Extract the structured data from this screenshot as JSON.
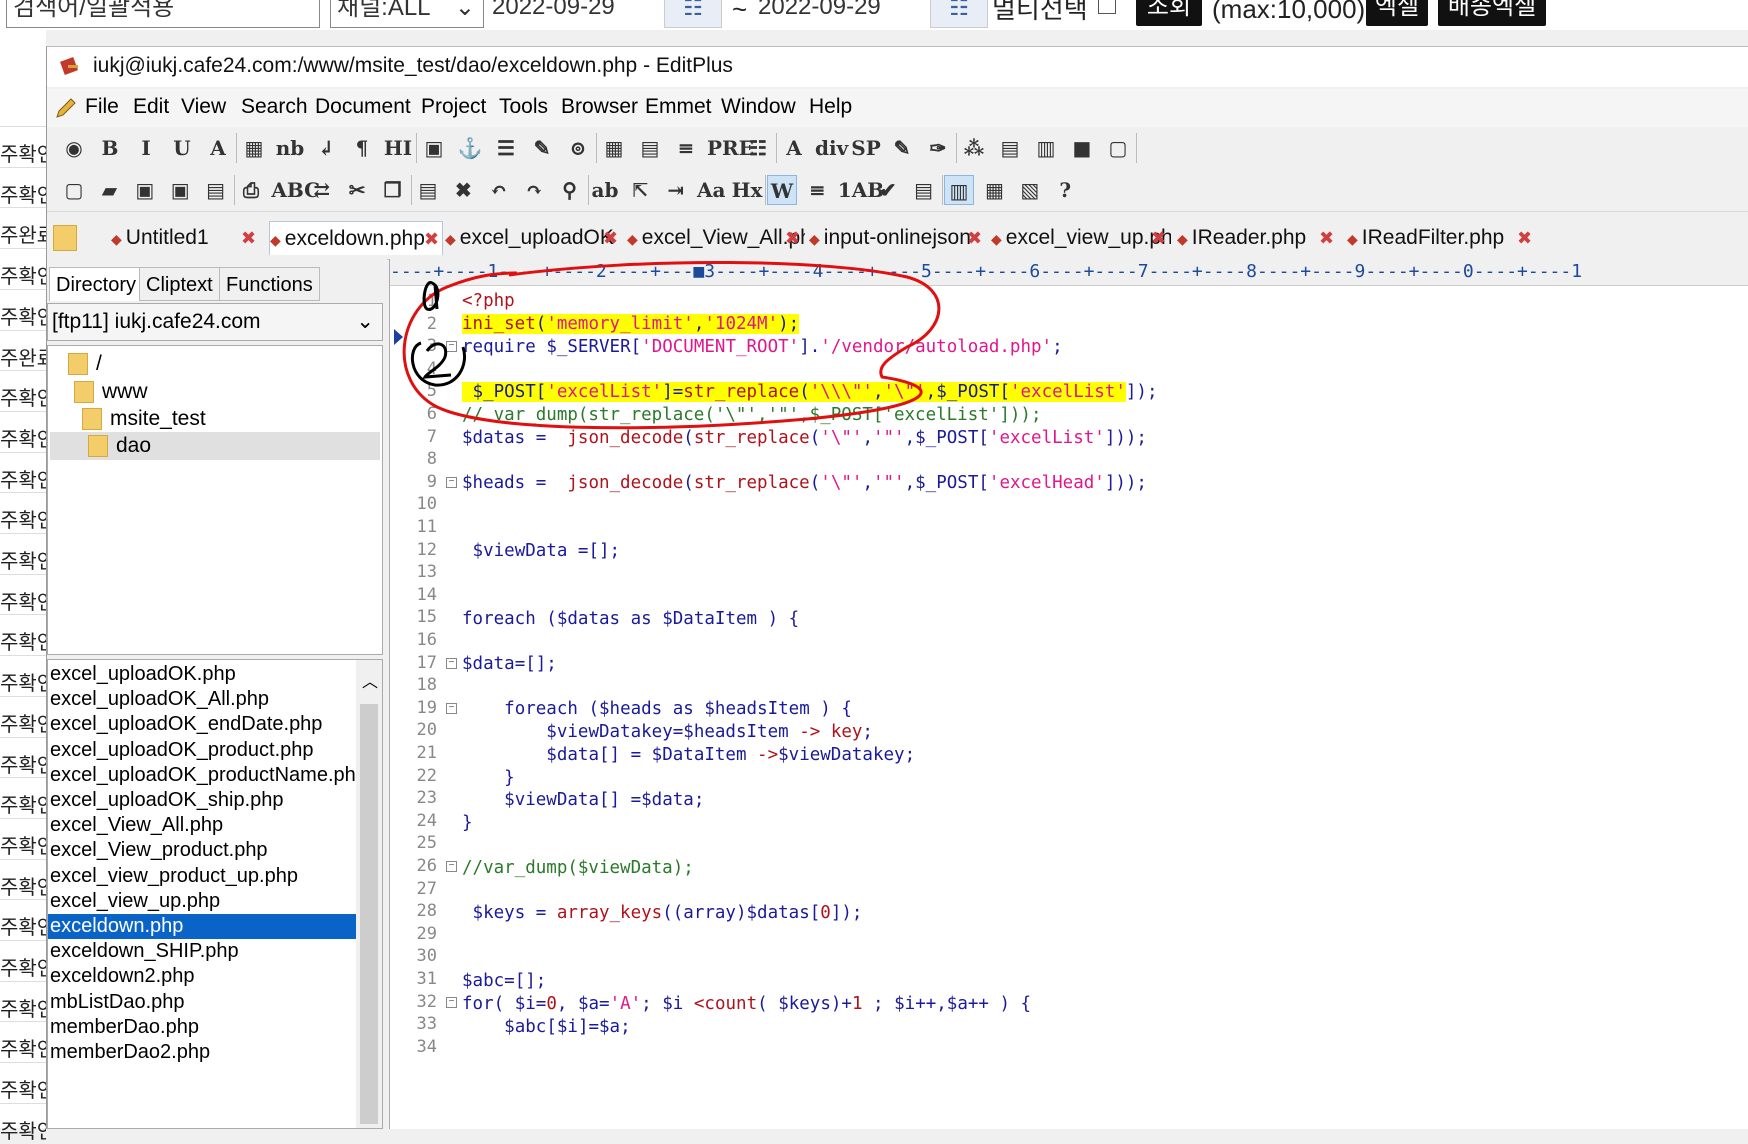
{
  "web": {
    "search_placeholder": "검색어/일괄적용",
    "channel": "채널:ALL",
    "date_from": "2022-09-29",
    "date_sep": "~",
    "date_to": "2022-09-29",
    "multi_select": "멀티선택",
    "search_btn": "조회",
    "max_text": "(max:10,000)",
    "excel_btn": "엑셀",
    "ship_excel_btn": "배송엑셀",
    "left_labels": [
      "주확인",
      "주확인",
      "주완료",
      "주확인",
      "주확인",
      "주완료",
      "주확인",
      "주확인",
      "주확인",
      "주확인",
      "주확인",
      "주확인",
      "주확인",
      "주확인",
      "주확인",
      "주확인",
      "주확인",
      "주확인",
      "주확인",
      "주확인",
      "주확인",
      "주확인",
      "주확인",
      "주확인",
      "주확인"
    ]
  },
  "window": {
    "title": "iukj@iukj.cafe24.com:/www/msite_test/dao/exceldown.php - EditPlus",
    "menu": [
      "File",
      "Edit",
      "View",
      "Search",
      "Document",
      "Project",
      "Tools",
      "Browser",
      "Emmet",
      "Window",
      "Help"
    ]
  },
  "toolbar1": {
    "icons": [
      "globe-icon",
      "bold-icon",
      "italic-icon",
      "underline-icon",
      "font-color-icon",
      "color-grid-icon",
      "nbsp-icon",
      "line-break-icon",
      "paragraph-icon",
      "horizontal-rule-icon",
      "image-icon",
      "anchor-icon",
      "hr-lines-icon",
      "edit-box-icon",
      "stamp-icon",
      "table-icon",
      "form-icon",
      "align-icon",
      "pre-icon",
      "list-icon",
      "font-a-icon",
      "div-icon",
      "span-icon",
      "pencil-icon",
      "brush-icon",
      "pills-icon",
      "frame-icon",
      "layout-icon",
      "palette-icon",
      "window-icon"
    ],
    "glyphs": [
      "◉",
      "B",
      "I",
      "U",
      "A",
      "▦",
      "nb",
      "↲",
      "¶",
      "HI",
      "▣",
      "⚓",
      "☰",
      "✎",
      "⊚",
      "▦",
      "▤",
      "≡",
      "PRE",
      "☷",
      "A",
      "div",
      "SP",
      "✎",
      "✑",
      "⁂",
      "▤",
      "▥",
      "■",
      "▢"
    ]
  },
  "toolbar2": {
    "icons": [
      "new-file-icon",
      "open-folder-icon",
      "save-icon",
      "save-all-icon",
      "print-preview-icon",
      "print-icon",
      "spellcheck-icon",
      "ftp-icon",
      "cut-icon",
      "copy-icon",
      "paste-icon",
      "delete-icon",
      "undo-icon",
      "redo-icon",
      "find-icon",
      "replace-icon",
      "goto-icon",
      "indent-icon",
      "font-size-icon",
      "header-icon",
      "word-wrap-icon",
      "column-icon",
      "line-number-icon",
      "check-icon",
      "doc-icon",
      "doc-split-icon",
      "doc-view-icon",
      "doc-switch-icon",
      "help-icon"
    ],
    "glyphs": [
      "▢",
      "▰",
      "▣",
      "▣",
      "▤",
      "⎙",
      "ABC",
      "⇄",
      "✂",
      "❐",
      "▤",
      "✖",
      "↶",
      "↷",
      "⚲",
      "ab",
      "⇱",
      "⇥",
      "Aa",
      "Hx",
      "W",
      "≡",
      "1AB",
      "✔",
      "▤",
      "▥",
      "▦",
      "▧",
      "?"
    ]
  },
  "tabs": [
    "Untitled1",
    "exceldown.php",
    "excel_uploadOK",
    "excel_View_All.ph",
    "input-onlinejson",
    "excel_view_up.ph",
    "IReader.php",
    "IReadFilter.php"
  ],
  "panel": {
    "tabs": [
      "Directory",
      "Cliptext",
      "Functions"
    ],
    "drive": "[ftp11] iukj.cafe24.com",
    "tree": [
      "/",
      "www",
      "msite_test",
      "dao"
    ],
    "files": [
      "excel_uploadOK.php",
      "excel_uploadOK_All.php",
      "excel_uploadOK_endDate.php",
      "excel_uploadOK_product.php",
      "excel_uploadOK_productName.php",
      "excel_uploadOK_ship.php",
      "excel_View_All.php",
      "excel_View_product.php",
      "excel_view_product_up.php",
      "excel_view_up.php",
      "exceldown.php",
      "exceldown_SHIP.php",
      "exceldown2.php",
      "mbListDao.php",
      "memberDao.php",
      "memberDao2.php"
    ],
    "selected_file": "exceldown.php"
  },
  "editor": {
    "ruler": "----+----1----+----2----+---■3----+----4----+----5----+----6----+----7----+----8----+----9----+----0----+----1",
    "line_numbers": [
      "1",
      "2",
      "3",
      "4",
      "5",
      "6",
      "7",
      "8",
      "9",
      "10",
      "11",
      "12",
      "13",
      "14",
      "15",
      "16",
      "17",
      "18",
      "19",
      "20",
      "21",
      "22",
      "23",
      "24",
      "25",
      "26",
      "27",
      "28",
      "29",
      "30",
      "31",
      "32",
      "33",
      "34"
    ],
    "annotations": [
      "1",
      "2"
    ]
  }
}
